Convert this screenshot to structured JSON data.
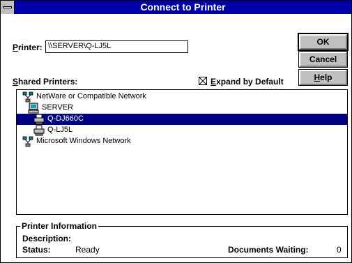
{
  "window": {
    "title": "Connect to Printer"
  },
  "printer": {
    "label_mnemonic": "P",
    "label_rest": "rinter:",
    "value": "\\\\SERVER\\Q-LJ5L"
  },
  "buttons": {
    "ok": "OK",
    "cancel": "Cancel",
    "help_mnemonic": "H",
    "help_rest": "elp"
  },
  "shared_printers": {
    "label_mnemonic": "S",
    "label_rest": "hared Printers:"
  },
  "expand_by_default": {
    "checked": true,
    "label_mnemonic": "E",
    "label_rest": "xpand by Default"
  },
  "tree": [
    {
      "label": "NetWare or Compatible Network",
      "icon": "network-icon",
      "level": 0,
      "selected": false
    },
    {
      "label": "SERVER",
      "icon": "server-icon",
      "level": 1,
      "selected": false
    },
    {
      "label": "Q-DJ660C",
      "icon": "printer-icon",
      "level": 2,
      "selected": true
    },
    {
      "label": "Q-LJ5L",
      "icon": "printer-icon",
      "level": 2,
      "selected": false
    },
    {
      "label": "Microsoft Windows Network",
      "icon": "network-icon",
      "level": 0,
      "selected": false
    }
  ],
  "printer_information": {
    "title": "Printer Information",
    "description_label": "Description:",
    "description_value": "",
    "status_label": "Status:",
    "status_value": "Ready",
    "documents_waiting_label": "Documents Waiting:",
    "documents_waiting_value": "0"
  },
  "colors": {
    "titlebar": "#0000a8",
    "selection": "#000080",
    "button_face": "#c0c0c0"
  }
}
